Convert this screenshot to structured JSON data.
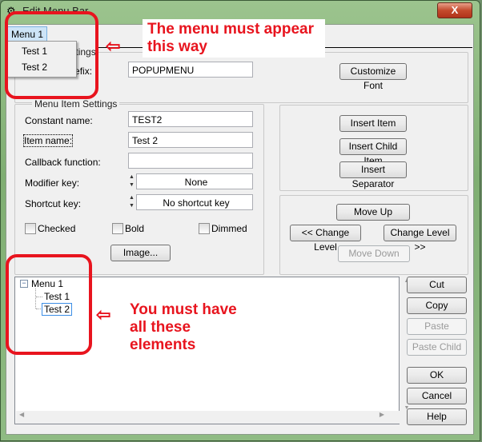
{
  "window": {
    "title": "Edit Menu Bar",
    "close_label": "X"
  },
  "menubar": {
    "menu": "Menu 1",
    "dropdown": [
      "Test 1",
      "Test 2"
    ]
  },
  "menu_settings": {
    "group_label": "Menu Settings",
    "prefix_label": "Constant prefix:",
    "prefix_value": "POPUPMENU",
    "customize_font": "Customize Font"
  },
  "item_settings": {
    "group_label": "Menu Item Settings",
    "constant_label": "Constant name:",
    "constant_value": "TEST2",
    "item_label": "Item name:",
    "item_value": "Test 2",
    "callback_label": "Callback function:",
    "callback_value": "",
    "modifier_label": "Modifier key:",
    "modifier_value": "None",
    "shortcut_label": "Shortcut key:",
    "shortcut_value": "No shortcut key",
    "checked": "Checked",
    "bold": "Bold",
    "dimmed": "Dimmed",
    "image": "Image..."
  },
  "insert": {
    "item": "Insert Item",
    "child": "Insert Child Item",
    "separator": "Insert Separator"
  },
  "move": {
    "up": "Move Up",
    "level_left": "<< Change Level",
    "level_right": "Change Level >>",
    "down": "Move Down"
  },
  "tree": {
    "root": "Menu 1",
    "children": [
      "Test 1",
      "Test 2"
    ],
    "selected": "Test 2"
  },
  "side_buttons": {
    "cut": "Cut",
    "copy": "Copy",
    "paste": "Paste",
    "paste_child": "Paste Child",
    "ok": "OK",
    "cancel": "Cancel",
    "help": "Help"
  },
  "annotations": {
    "top": "The menu must appear this way",
    "bottom": "You must have all these elements",
    "color": "#e8141e"
  }
}
